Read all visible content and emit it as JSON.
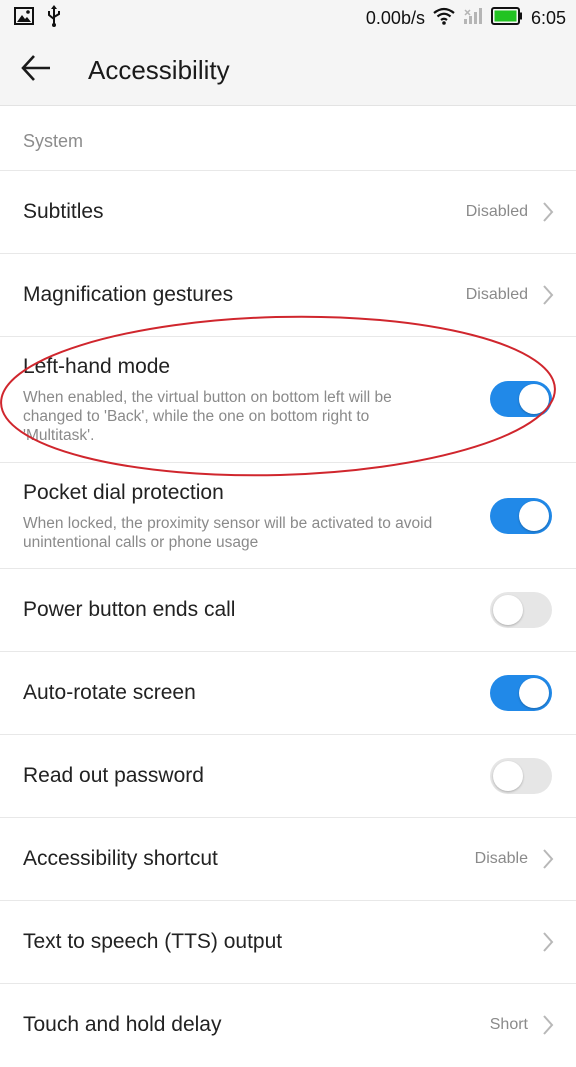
{
  "status_bar": {
    "network_speed": "0.00b/s",
    "time": "6:05",
    "icons": [
      "image-notification-icon",
      "usb-icon",
      "wifi-icon",
      "signal-icon",
      "battery-icon"
    ]
  },
  "header": {
    "title": "Accessibility",
    "back_icon": "back-arrow-icon"
  },
  "section": {
    "title": "System"
  },
  "items": [
    {
      "label": "Subtitles",
      "value": "Disabled",
      "type": "link"
    },
    {
      "label": "Magnification gestures",
      "value": "Disabled",
      "type": "link"
    },
    {
      "label": "Left-hand mode",
      "description": "When enabled, the virtual button on bottom left will be changed to 'Back', while the one on bottom right to 'Multitask'.",
      "type": "toggle",
      "checked": true
    },
    {
      "label": "Pocket dial protection",
      "description": "When locked, the proximity sensor will be activated to avoid unintentional calls or phone usage",
      "type": "toggle",
      "checked": true
    },
    {
      "label": "Power button ends call",
      "type": "toggle",
      "checked": false
    },
    {
      "label": "Auto-rotate screen",
      "type": "toggle",
      "checked": true
    },
    {
      "label": "Read out password",
      "type": "toggle",
      "checked": false
    },
    {
      "label": "Accessibility shortcut",
      "value": "Disable",
      "type": "link"
    },
    {
      "label": "Text to speech (TTS) output",
      "type": "link"
    },
    {
      "label": "Touch and hold delay",
      "value": "Short",
      "type": "link"
    }
  ],
  "colors": {
    "toggle_on": "#2189e8",
    "toggle_off": "#e6e6e6",
    "annotation": "#d0262d",
    "battery": "#22c322"
  }
}
